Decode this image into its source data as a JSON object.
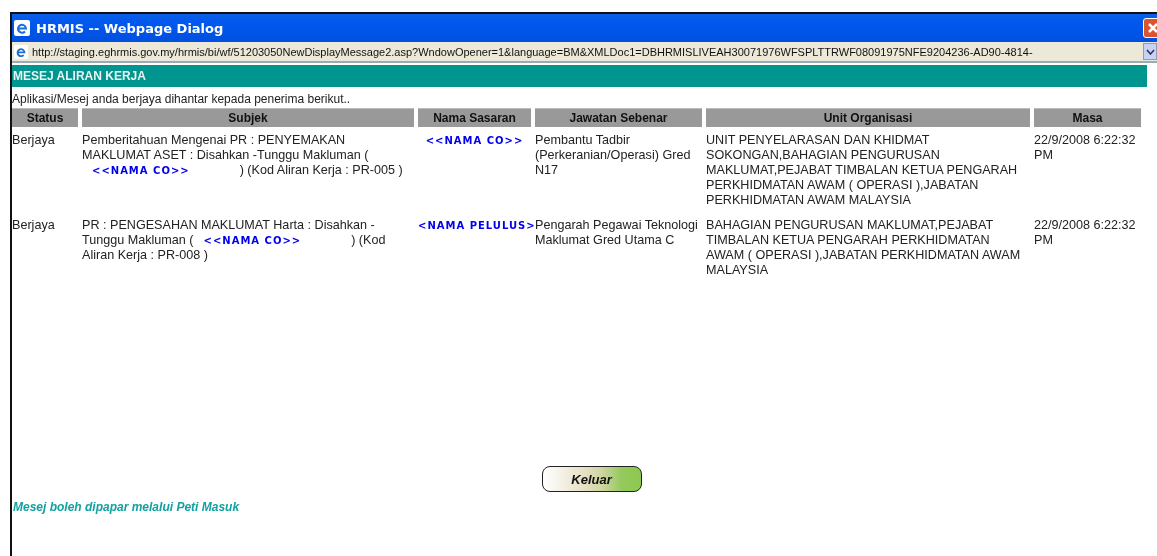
{
  "window": {
    "title": "HRMIS -- Webpage Dialog",
    "address": "http://staging.eghrmis.gov.my/hrmis/bi/wf/51203050NewDisplayMessage2.asp?WndowOpener=1&language=BM&XMLDoc1=DBHRMISLIVEAH30071976WFSPLTTRWF08091975NFE9204236-AD90-4814-"
  },
  "section_title": "MESEJ ALIRAN KERJA",
  "intro": "Aplikasi/Mesej anda berjaya dihantar kepada penerima berikut..",
  "table": {
    "columns": [
      "Status",
      "Subjek",
      "Nama Sasaran",
      "Jawatan Sebenar",
      "Unit Organisasi",
      "Masa"
    ],
    "rows": [
      {
        "status": "Berjaya",
        "subject": [
          {
            "kind": "text",
            "text": "Pemberitahuan Mengenai PR : PENYEMAKAN MAKLUMAT ASET : Disahkan -Tunggu Makluman ("
          },
          {
            "kind": "name",
            "text": "<<NAMA CO>>"
          },
          {
            "kind": "text",
            "text": ") (Kod Aliran Kerja : PR-005 )"
          }
        ],
        "target": "<<NAMA CO>>",
        "position": "Pembantu Tadbir (Perkeranian/Operasi) Gred N17",
        "unit": "UNIT PENYELARASAN DAN KHIDMAT SOKONGAN,BAHAGIAN PENGURUSAN MAKLUMAT,PEJABAT TIMBALAN KETUA PENGARAH PERKHIDMATAN AWAM ( OPERASI ),JABATAN PERKHIDMATAN AWAM MALAYSIA",
        "time": "22/9/2008 6:22:32 PM"
      },
      {
        "status": "Berjaya",
        "subject": [
          {
            "kind": "text",
            "text": "PR : PENGESAHAN MAKLUMAT Harta : Disahkan - Tunggu Makluman ("
          },
          {
            "kind": "name",
            "text": "<<NAMA CO>>"
          },
          {
            "kind": "text",
            "text": ") (Kod Aliran Kerja : PR-008 )"
          }
        ],
        "target": "<NAMA PELULUS>",
        "position": "Pengarah Pegawai Teknologi Maklumat Gred Utama C",
        "unit": "BAHAGIAN PENGURUSAN MAKLUMAT,PEJABAT TIMBALAN KETUA PENGARAH PERKHIDMATAN AWAM ( OPERASI ),JABATAN PERKHIDMATAN AWAM MALAYSIA",
        "time": "22/9/2008 6:22:32 PM"
      }
    ]
  },
  "button": "Keluar",
  "footer": "Mesej boleh dipapar melalui Peti Masuk"
}
